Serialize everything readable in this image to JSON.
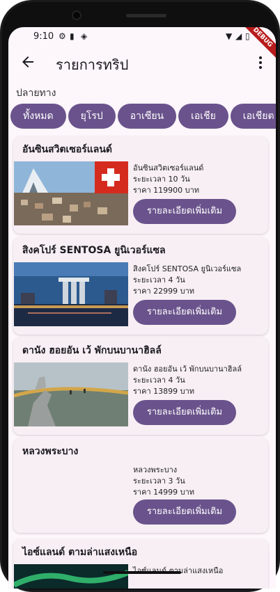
{
  "status_bar": {
    "time": "9:10"
  },
  "debug_ribbon": "DEBUG",
  "app_bar": {
    "title": "รายการทริป"
  },
  "destination_label": "ปลายทาง",
  "chips": [
    "ทั้งหมด",
    "ยุโรป",
    "อาเซียน",
    "เอเชีย",
    "เอเชียต"
  ],
  "trips": [
    {
      "title": "อันซินสวิตเซอร์แลนด์",
      "name": "อันซินสวิตเซอร์แลนด์",
      "duration": "ระยะเวลา 10 วัน",
      "price": "ราคา 119900 บาท",
      "button": "รายละเอียดเพิ่มเติม"
    },
    {
      "title": "สิงคโปร์ SENTOSA ยูนิเวอร์แซล",
      "name": "สิงคโปร์ SENTOSA ยูนิเวอร์แซล",
      "duration": "ระยะเวลา 4 วัน",
      "price": "ราคา 22999 บาท",
      "button": "รายละเอียดเพิ่มเติม"
    },
    {
      "title": "ดานัง ฮอยอัน เว้ พักบนบานาฮิลล์",
      "name": "ดานัง ฮอยอัน เว้ พักบนบานาฮิลล์",
      "duration": "ระยะเวลา 4 วัน",
      "price": "ราคา 13899 บาท",
      "button": "รายละเอียดเพิ่มเติม"
    },
    {
      "title": "หลวงพระบาง",
      "name": "หลวงพระบาง",
      "duration": "ระยะเวลา 3 วัน",
      "price": "ราคา 14999 บาท",
      "button": "รายละเอียดเพิ่มเติม"
    },
    {
      "title": "ไอซ์แลนด์ ตามล่าแสงเหนือ",
      "name": "ไอซ์แลนด์ ตามล่าแสงเหนือ"
    }
  ],
  "colors": {
    "primary": "#6a538c",
    "background": "#fdf6fb",
    "card": "#f7eff4"
  }
}
